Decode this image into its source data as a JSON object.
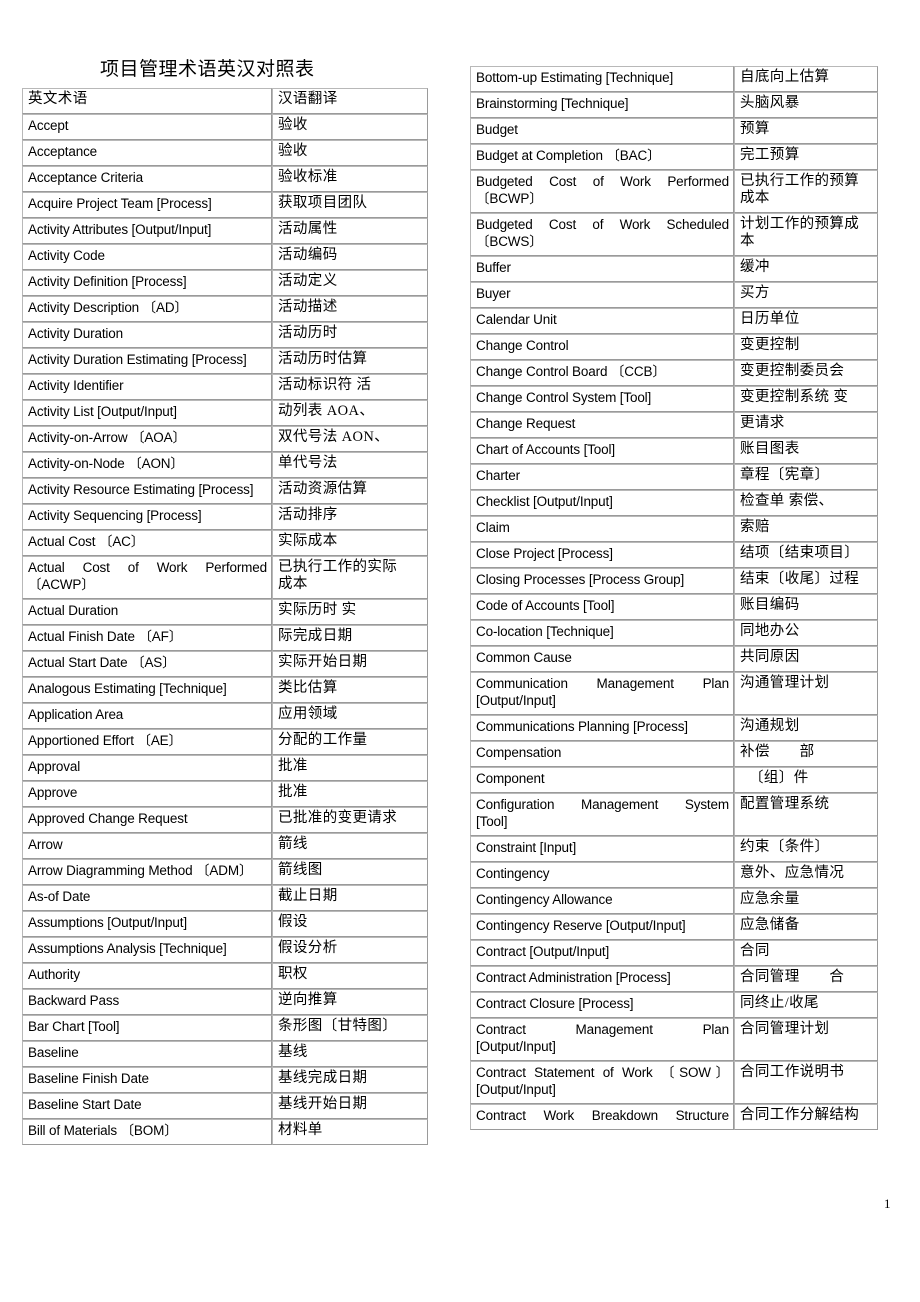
{
  "document": {
    "title": "项目管理术语英汉对照表",
    "page_number": "1"
  },
  "left_table": {
    "headers": {
      "en": "英文术语",
      "zh": "汉语翻译"
    },
    "rows": [
      {
        "en": "Accept",
        "zh": "验收"
      },
      {
        "en": "Acceptance",
        "zh": "验收"
      },
      {
        "en": "Acceptance Criteria",
        "zh": "验收标准"
      },
      {
        "en": "Acquire Project Team [Process]",
        "zh": "获取项目团队"
      },
      {
        "en": "Activity Attributes [Output/Input]",
        "zh": "活动属性"
      },
      {
        "en": "Activity Code",
        "zh": "活动编码"
      },
      {
        "en": "Activity Definition [Process]",
        "zh": "活动定义"
      },
      {
        "en": "Activity Description  〔AD〕",
        "zh": "活动描述"
      },
      {
        "en": "Activity Duration",
        "zh": "活动历时"
      },
      {
        "en": "Activity Duration Estimating [Process]",
        "zh": "活动历时估算"
      },
      {
        "en": "Activity Identifier",
        "zh": "活动标识符    活"
      },
      {
        "en": "Activity List [Output/Input]",
        "zh": "动列表    AOA、"
      },
      {
        "en": "Activity-on-Arrow  〔AOA〕",
        "zh": "双代号法 AON、"
      },
      {
        "en": "Activity-on-Node  〔AON〕",
        "zh": "单代号法"
      },
      {
        "en": "Activity Resource Estimating [Process]",
        "zh": "活动资源估算"
      },
      {
        "en": "Activity Sequencing [Process]",
        "zh": "活动排序"
      },
      {
        "en": "Actual Cost  〔AC〕",
        "zh": "实际成本"
      },
      {
        "en_l1": "Actual  Cost  of  Work  Performed",
        "en_l2": "〔ACWP〕",
        "zh": "已执行工作的实际\n成本",
        "tall": true
      },
      {
        "en": "Actual Duration",
        "zh": "实际历时 实"
      },
      {
        "en": "Actual Finish Date  〔AF〕",
        "zh": "际完成日期"
      },
      {
        "en": "Actual Start Date  〔AS〕",
        "zh": "实际开始日期"
      },
      {
        "en": "Analogous Estimating [Technique]",
        "zh": "类比估算"
      },
      {
        "en": "Application Area",
        "zh": "应用领域"
      },
      {
        "en": "Apportioned Effort  〔AE〕",
        "zh": "分配的工作量"
      },
      {
        "en": "Approval",
        "zh": "批准"
      },
      {
        "en": "Approve",
        "zh": "批准"
      },
      {
        "en": "Approved Change Request",
        "zh": "已批准的变更请求"
      },
      {
        "en": "Arrow",
        "zh": "箭线"
      },
      {
        "en": "Arrow Diagramming Method 〔ADM〕",
        "zh": "箭线图"
      },
      {
        "en": "As-of Date",
        "zh": "截止日期"
      },
      {
        "en": "Assumptions [Output/Input]",
        "zh": "假设"
      },
      {
        "en": "Assumptions Analysis [Technique]",
        "zh": "假设分析"
      },
      {
        "en": "Authority",
        "zh": "职权"
      },
      {
        "en": "Backward Pass",
        "zh": "逆向推算"
      },
      {
        "en": "Bar Chart [Tool]",
        "zh": "条形图〔甘特图〕"
      },
      {
        "en": "Baseline",
        "zh": "基线"
      },
      {
        "en": "Baseline Finish Date",
        "zh": "基线完成日期"
      },
      {
        "en": "Baseline Start Date",
        "zh": "基线开始日期"
      },
      {
        "en": "Bill of Materials  〔BOM〕",
        "zh": "材料单"
      }
    ]
  },
  "right_table": {
    "rows": [
      {
        "en": "Bottom-up Estimating [Technique]",
        "zh": "自底向上估算"
      },
      {
        "en": "Brainstorming [Technique]",
        "zh": "头脑风暴"
      },
      {
        "en": "Budget",
        "zh": "预算"
      },
      {
        "en": "Budget at Completion  〔BAC〕",
        "zh": "完工预算"
      },
      {
        "en_l1": "Budgeted  Cost  of  Work  Performed",
        "en_l2": "〔BCWP〕",
        "zh": "已执行工作的预算\n成本",
        "tall": true
      },
      {
        "en_l1": "Budgeted  Cost  of  Work  Scheduled",
        "en_l2": "〔BCWS〕",
        "zh": "计划工作的预算成\n本",
        "tall": true
      },
      {
        "en": "Buffer",
        "zh": "缓冲"
      },
      {
        "en": "Buyer",
        "zh": "买方"
      },
      {
        "en": "Calendar Unit",
        "zh": "日历单位"
      },
      {
        "en": "Change Control",
        "zh": "变更控制"
      },
      {
        "en": "Change Control Board  〔CCB〕",
        "zh": "变更控制委员会"
      },
      {
        "en": "Change Control System [Tool]",
        "zh": "变更控制系统 变"
      },
      {
        "en": "Change Request",
        "zh": "更请求"
      },
      {
        "en": "Chart of Accounts [Tool]",
        "zh": "账目图表"
      },
      {
        "en": "Charter",
        "zh": "章程〔宪章〕"
      },
      {
        "en": "Checklist [Output/Input]",
        "zh": "检查单 索偿、"
      },
      {
        "en": "Claim",
        "zh": "索赔"
      },
      {
        "en": "Close Project [Process]",
        "zh": "结项〔结束项目〕"
      },
      {
        "en": "Closing Processes [Process Group]",
        "zh": "结束〔收尾〕过程"
      },
      {
        "en": "Code of Accounts [Tool]",
        "zh": "账目编码"
      },
      {
        "en": "Co-location [Technique]",
        "zh": "同地办公"
      },
      {
        "en": "Common Cause",
        "zh": "共同原因"
      },
      {
        "en_l1": "Communication    Management    Plan",
        "en_l2": "[Output/Input]",
        "zh": "沟通管理计划",
        "tall": true
      },
      {
        "en": "Communications Planning [Process]",
        "zh": "沟通规划"
      },
      {
        "en": "Compensation",
        "zh": "补偿　　部"
      },
      {
        "en": "Component",
        "zh": "〔组〕件",
        "zh_indent": true
      },
      {
        "en_l1": "Configuration    Management    System",
        "en_l2": "[Tool]",
        "zh": "配置管理系统",
        "tall": true
      },
      {
        "en": "Constraint [Input]",
        "zh": "约束〔条件〕"
      },
      {
        "en": "Contingency",
        "zh": "意外、应急情况"
      },
      {
        "en": "Contingency Allowance",
        "zh": "应急余量"
      },
      {
        "en": "Contingency Reserve [Output/Input]",
        "zh": "应急储备"
      },
      {
        "en": "Contract [Output/Input]",
        "zh": "合同"
      },
      {
        "en": "Contract Administration [Process]",
        "zh": "合同管理　　合"
      },
      {
        "en": "Contract Closure [Process]",
        "zh": "同终止/收尾"
      },
      {
        "en_l1": "Contract        Management        Plan",
        "en_l2": "[Output/Input]",
        "zh": "合同管理计划",
        "tall": true
      },
      {
        "en_l1": "Contract Statement of Work 〔SOW〕",
        "en_l2": "[Output/Input]",
        "zh": "合同工作说明书",
        "tall": true
      },
      {
        "en": "Contract  Work  Breakdown  Structure",
        "zh": "合同工作分解结构",
        "en_justify": true
      }
    ]
  }
}
